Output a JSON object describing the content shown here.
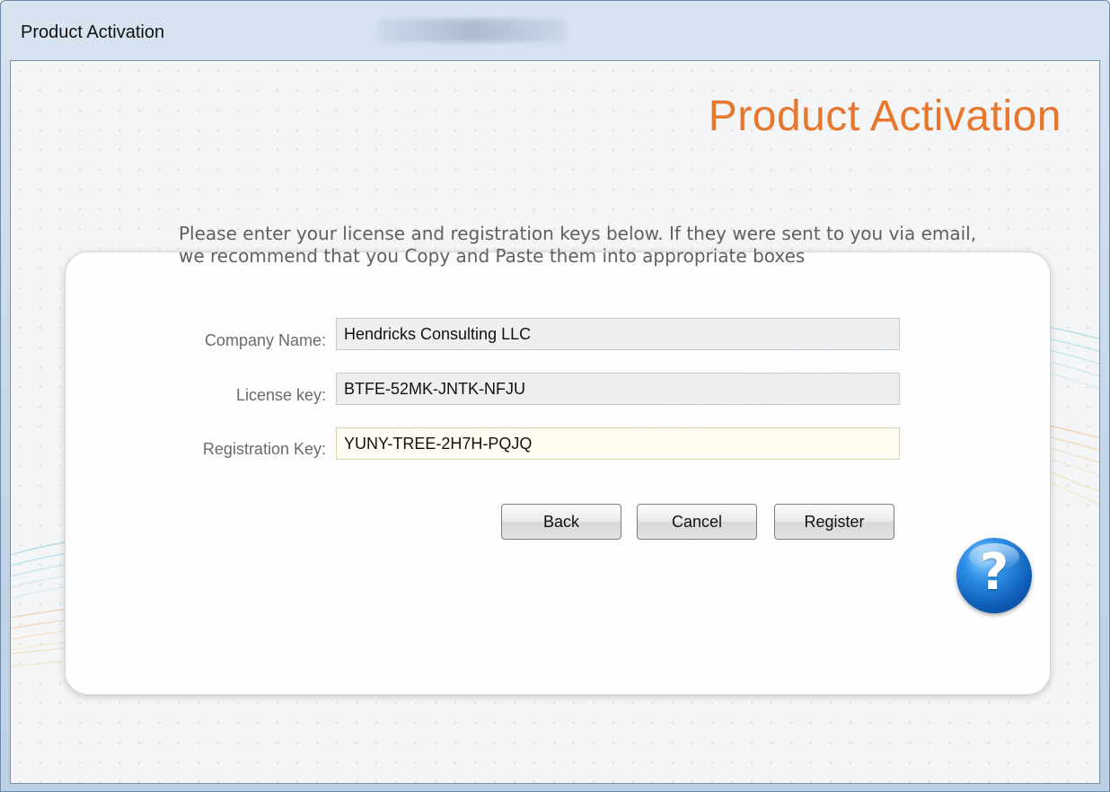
{
  "window": {
    "title": "Product Activation"
  },
  "header": {
    "title": "Product Activation",
    "title_color": "#e8772e"
  },
  "form": {
    "instructions": "Please enter your license and registration keys below. If they were sent to you via email, we recommend that you Copy and Paste them into appropriate boxes",
    "fields": [
      {
        "label": "Company Name:",
        "value": "Hendricks Consulting LLC"
      },
      {
        "label": "License key:",
        "value": "BTFE-52MK-JNTK-NFJU"
      },
      {
        "label": "Registration Key:",
        "value": "YUNY-TREE-2H7H-PQJQ"
      }
    ]
  },
  "buttons": {
    "back": "Back",
    "cancel": "Cancel",
    "register": "Register"
  },
  "help": {
    "icon": "help-question-icon",
    "glyph": "?"
  }
}
